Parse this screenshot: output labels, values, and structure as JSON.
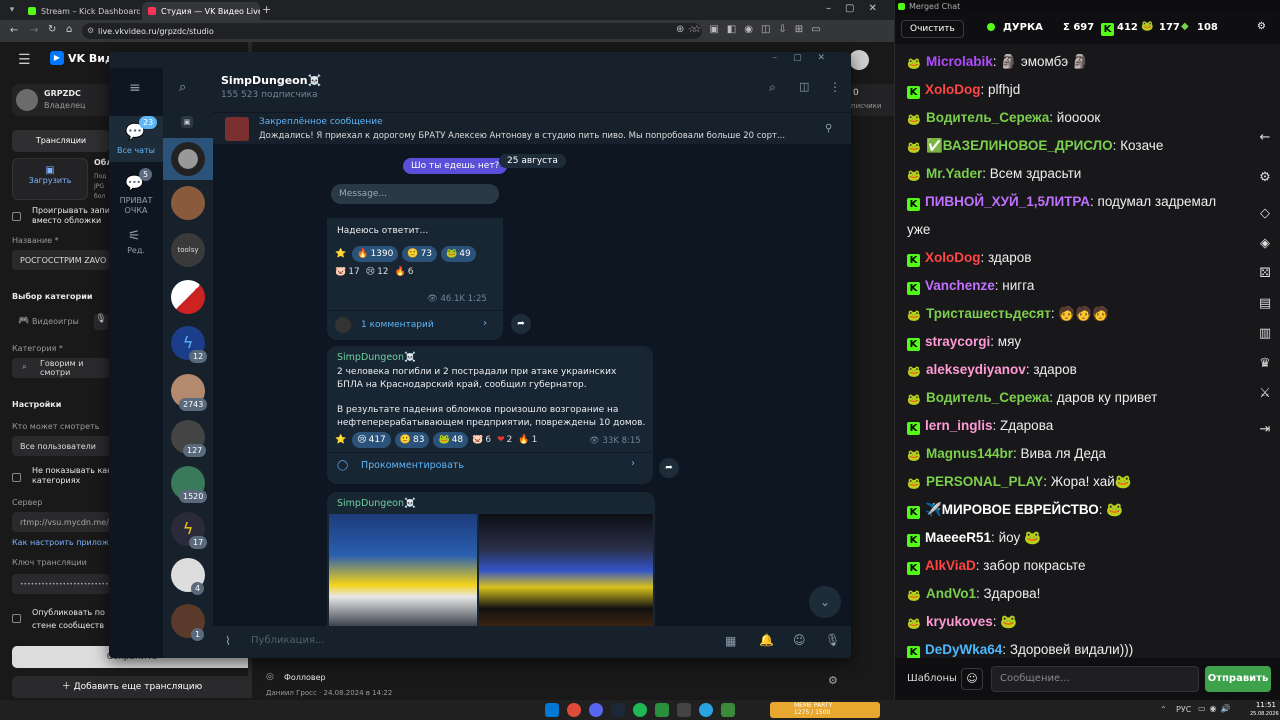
{
  "browser": {
    "tabs": [
      {
        "label": "Stream – Kick Dashboard",
        "color": "#53fc18"
      },
      {
        "label": "Студия — VK Видео Live",
        "color": "#ff3355"
      }
    ],
    "url": "live.vkvideo.ru/grpzdc/studio"
  },
  "vk": {
    "logo": "VK Видео",
    "channel_name": "GRPZDC",
    "channel_role": "Владелец",
    "tab_streams": "Трансляции",
    "upload_label": "Загрузить",
    "cover_title": "Обл",
    "cover_hint": "Под\nJPG\nбол",
    "play_instead": "Проигрывать запис\nвместо обложки",
    "name_label": "Название *",
    "name_value": "РОСГОССТРИМ ZAVO",
    "category_choice_label": "Выбор категории",
    "category_tab": "Видеоигры",
    "category_label": "Категория *",
    "category_value": "Говорим и смотри",
    "settings_label": "Настройки",
    "who_watch_label": "Кто может смотреть",
    "who_watch_value": "Все пользователи",
    "hide_label": "Не показывать кана\nкатегориях",
    "server_label": "Сервер",
    "server_value": "rtmp://vsu.mycdn.me/inp",
    "how_connect": "Как настроить приложен",
    "key_label": "Ключ трансляции",
    "key_value": "••••••••••••••••••••••••••••",
    "publish_label": "Опубликовать по\nстене сообществ",
    "save_label": "Сохранить",
    "add_stream": "Добавить еще трансляцию",
    "follower_label": "Фолловер",
    "follower_sub": "Даниил Гросс · 24.08.2024 в 14:22",
    "right_num": "0",
    "right_sub": "писчики",
    "overlay_label": "MEME PARTY",
    "overlay_value": "1275 / 1500"
  },
  "telegram": {
    "nav": [
      {
        "label": "Все чаты",
        "badge": "23"
      },
      {
        "label": "ПРИВАТ\nОЧКА",
        "badge": "5"
      },
      {
        "label": "Ред.",
        "badge": ""
      }
    ],
    "chat_list_badges": [
      "",
      "",
      "",
      "",
      "",
      "12",
      "2743",
      "127",
      "1520",
      "17",
      "4",
      "1"
    ],
    "list_text_3": "toolsy",
    "channel_title": "SimpDungeon☠️",
    "subscribers": "155 523 подписчика",
    "pinned_title": "Закреплённое сообщение",
    "pinned_text": "Дождались!  Я приехал к дорогому БРАТУ Алексею Антонову в студию пить пиво. Мы попробовали больше 20 сорт...",
    "video_question": "Шо ты едешь нет?",
    "video_message_placeholder": "Message...",
    "date_badge": "25 августа",
    "post1": {
      "text": "Надеюсь ответит...",
      "reactions": [
        {
          "emoji": "⭐",
          "count": ""
        },
        {
          "emoji": "🔥",
          "count": "1390"
        },
        {
          "emoji": "🙂",
          "count": "73"
        },
        {
          "emoji": "🐸",
          "count": "49"
        },
        {
          "emoji": "🐷",
          "count": "17"
        },
        {
          "emoji": "😢",
          "count": "12"
        },
        {
          "emoji": "🔥",
          "count": "6"
        }
      ],
      "views": "46.1K",
      "time": "1:25",
      "comments": "1 комментарий"
    },
    "post2": {
      "author": "SimpDungeon☠️",
      "text1": "2 человека погибли и 2 пострадали при атаке украинских БПЛА на Краснодарский край, сообщил губернатор.",
      "text2": "В результате падения обломков произошло возгорание на нефтеперерабатывающем предприятии, повреждены 10 домов.",
      "reactions": [
        {
          "emoji": "⭐",
          "count": ""
        },
        {
          "emoji": "😢",
          "count": "417"
        },
        {
          "emoji": "🙂",
          "count": "83"
        },
        {
          "emoji": "🐸",
          "count": "48"
        },
        {
          "emoji": "🐷",
          "count": "6"
        },
        {
          "emoji": "❤",
          "count": "2"
        },
        {
          "emoji": "🔥",
          "count": "1"
        }
      ],
      "views": "33K",
      "time": "8:15",
      "comment_cta": "Прокомментировать"
    },
    "post3": {
      "author": "SimpDungeon☠️"
    },
    "compose_placeholder": "Публикация..."
  },
  "chat": {
    "window_title": "Merged Chat",
    "clear_label": "Очистить",
    "title": "ДУРКА",
    "sum_label": "Σ 697",
    "kick_count": "412",
    "vk_count": "177",
    "other_count": "108",
    "messages": [
      {
        "platform": "vk",
        "user": "Microlabik",
        "color": "#b04cff",
        "text": "🗿 эмомбэ 🗿"
      },
      {
        "platform": "kick",
        "user": "XoloDog",
        "color": "#ff4444",
        "text": "plfhjd"
      },
      {
        "platform": "vk",
        "user": "Водитель_Сережа",
        "color": "#7ccf4c",
        "text": "йоооок"
      },
      {
        "platform": "vk",
        "user": "✅ВАЗЕЛИНОВОЕ_ДРИСЛО",
        "color": "#7ccf4c",
        "text": "Козаче"
      },
      {
        "platform": "vk",
        "user": "Mr.Yader",
        "color": "#7ccf4c",
        "text": "Всем здрасьти"
      },
      {
        "platform": "kick",
        "user": "ПИВНОЙ_ХУЙ_1,5ЛИТРА",
        "color": "#c070ff",
        "text": "подумал задремал уже"
      },
      {
        "platform": "kick",
        "user": "XoloDog",
        "color": "#ff4444",
        "text": "здаров"
      },
      {
        "platform": "kick",
        "user": "Vanchenze",
        "color": "#c070ff",
        "text": "нигга"
      },
      {
        "platform": "vk",
        "user": "Тристашестьдесят",
        "color": "#7ccf4c",
        "text": "🧑🧑🧑"
      },
      {
        "platform": "kick",
        "user": "straycorgi",
        "color": "#ff9ad5",
        "text": "мяу"
      },
      {
        "platform": "vk",
        "user": "alekseydiyanov",
        "color": "#ff9ad5",
        "text": "здаров"
      },
      {
        "platform": "vk",
        "user": "Водитель_Сережа",
        "color": "#7ccf4c",
        "text": "даров ку привет"
      },
      {
        "platform": "kick",
        "user": "lern_inglis",
        "color": "#ff9ad5",
        "text": "Zдарова"
      },
      {
        "platform": "vk",
        "user": "Magnus144br",
        "color": "#7ccf4c",
        "text": "Вива ля Деда"
      },
      {
        "platform": "vk",
        "user": "PERSONAL_PLAY",
        "color": "#7ccf4c",
        "text": "Жора! хай🐸"
      },
      {
        "platform": "kick",
        "user": "✈️МИРОВОЕ ЕВРЕЙСТВО",
        "color": "#ffffff",
        "text": "🐸"
      },
      {
        "platform": "kick",
        "user": "MaeeeR51",
        "color": "#ffffff",
        "text": "йоу 🐸"
      },
      {
        "platform": "kick",
        "user": "AlkViaD",
        "color": "#ff4444",
        "text": "забор покрасьте"
      },
      {
        "platform": "vk",
        "user": "AndVo1",
        "color": "#7ccf4c",
        "text": "Здарова!"
      },
      {
        "platform": "vk",
        "user": "kryukoves",
        "color": "#ff9ad5",
        "text": "🐸"
      },
      {
        "platform": "kick",
        "user": "DeDyWka64",
        "color": "#4db8ff",
        "text": "Здоровей видали)))"
      }
    ],
    "templates_label": "Шаблоны",
    "input_placeholder": "Сообщение...",
    "send_label": "Отправить",
    "side_icons": [
      "arrow-left-icon",
      "gear-icon",
      "diamond-icon",
      "gem-icon",
      "dice-icon",
      "list-icon",
      "bar-chart-icon",
      "trophy-icon",
      "swords-icon",
      "export-icon"
    ]
  },
  "taskbar": {
    "lang": "РУС",
    "time": "11:51",
    "date": "25.08.2026"
  },
  "colors": {
    "kick_green": "#53fc18",
    "tg_accent": "#5eb5f7",
    "tg_bubble": "#182533",
    "send_button": "#3ea14b"
  }
}
